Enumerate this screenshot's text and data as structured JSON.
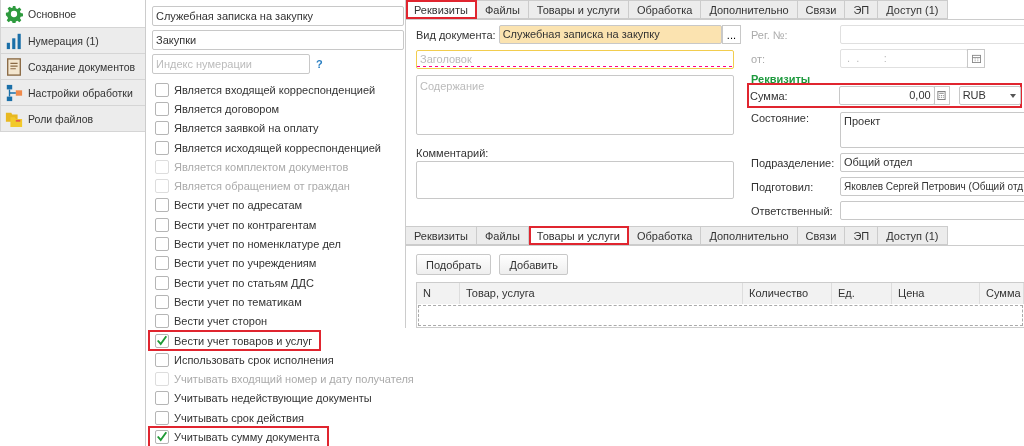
{
  "sidebar": {
    "items": [
      {
        "label": "Основное",
        "selected": true
      },
      {
        "label": "Нумерация (1)",
        "selected": false
      },
      {
        "label": "Создание документов",
        "selected": false
      },
      {
        "label": "Настройки обработки",
        "selected": false
      },
      {
        "label": "Роли файлов",
        "selected": false
      }
    ]
  },
  "form": {
    "fields": [
      {
        "value": "Служебная записка на закупку"
      },
      {
        "value": "Закупки"
      }
    ],
    "index_field": {
      "placeholder": "Индекс нумерации"
    },
    "help": "?",
    "checkboxes": [
      {
        "label": "Является входящей корреспонденцией",
        "checked": false,
        "disabled": false,
        "highlighted": false
      },
      {
        "label": "Является договором",
        "checked": false,
        "disabled": false,
        "highlighted": false
      },
      {
        "label": "Является заявкой на оплату",
        "checked": false,
        "disabled": false,
        "highlighted": false
      },
      {
        "label": "Является исходящей корреспонденцией",
        "checked": false,
        "disabled": false,
        "highlighted": false
      },
      {
        "label": "Является комплектом документов",
        "checked": false,
        "disabled": true,
        "highlighted": false
      },
      {
        "label": "Является обращением от граждан",
        "checked": false,
        "disabled": true,
        "highlighted": false
      },
      {
        "label": "Вести учет по адресатам",
        "checked": false,
        "disabled": false,
        "highlighted": false
      },
      {
        "label": "Вести учет по контрагентам",
        "checked": false,
        "disabled": false,
        "highlighted": false
      },
      {
        "label": "Вести учет по номенклатуре дел",
        "checked": false,
        "disabled": false,
        "highlighted": false
      },
      {
        "label": "Вести учет по учреждениям",
        "checked": false,
        "disabled": false,
        "highlighted": false
      },
      {
        "label": "Вести учет по статьям ДДС",
        "checked": false,
        "disabled": false,
        "highlighted": false
      },
      {
        "label": "Вести учет по тематикам",
        "checked": false,
        "disabled": false,
        "highlighted": false
      },
      {
        "label": "Вести учет сторон",
        "checked": false,
        "disabled": false,
        "highlighted": false
      },
      {
        "label": "Вести учет товаров и услуг",
        "checked": true,
        "disabled": false,
        "highlighted": true
      },
      {
        "label": "Использовать срок исполнения",
        "checked": false,
        "disabled": false,
        "highlighted": false
      },
      {
        "label": "Учитывать входящий номер и дату получателя",
        "checked": false,
        "disabled": true,
        "highlighted": false
      },
      {
        "label": "Учитывать недействующие документы",
        "checked": false,
        "disabled": false,
        "highlighted": false
      },
      {
        "label": "Учитывать срок действия",
        "checked": false,
        "disabled": false,
        "highlighted": false
      },
      {
        "label": "Учитывать сумму документа",
        "checked": true,
        "disabled": false,
        "highlighted": true
      }
    ]
  },
  "document": {
    "tabs": [
      {
        "label": "Реквизиты",
        "selected": true,
        "highlighted": true
      },
      {
        "label": "Файлы",
        "selected": false,
        "highlighted": false
      },
      {
        "label": "Товары и услуги",
        "selected": false,
        "highlighted": false
      },
      {
        "label": "Обработка",
        "selected": false,
        "highlighted": false
      },
      {
        "label": "Дополнительно",
        "selected": false,
        "highlighted": false
      },
      {
        "label": "Связи",
        "selected": false,
        "highlighted": false
      },
      {
        "label": "ЭП",
        "selected": false,
        "highlighted": false
      },
      {
        "label": "Доступ (1)",
        "selected": false,
        "highlighted": false
      }
    ],
    "doc_type": {
      "label": "Вид документа:",
      "value": "Служебная записка на закупку",
      "button": "..."
    },
    "title_field": {
      "placeholder": "Заголовок"
    },
    "content_field": {
      "placeholder": "Содержание"
    },
    "comment": {
      "label": "Комментарий:"
    },
    "reg_number": {
      "label": "Рег. №:"
    },
    "date": {
      "label": "от:",
      "placeholder": " .  .        :"
    },
    "section_title": "Реквизиты",
    "sum": {
      "label": "Сумма:",
      "value": "0,00",
      "currency": "RUB",
      "highlighted": true
    },
    "state": {
      "label": "Состояние:",
      "value": "Проект"
    },
    "department": {
      "label": "Подразделение:",
      "value": "Общий отдел"
    },
    "prepared_by": {
      "label": "Подготовил:",
      "value": "Яковлев Сергей Петрович (Общий отд"
    },
    "responsible": {
      "label": "Ответственный:"
    }
  },
  "goods": {
    "tabs": [
      {
        "label": "Реквизиты",
        "selected": false,
        "highlighted": false
      },
      {
        "label": "Файлы",
        "selected": false,
        "highlighted": false
      },
      {
        "label": "Товары и услуги",
        "selected": true,
        "highlighted": true
      },
      {
        "label": "Обработка",
        "selected": false,
        "highlighted": false
      },
      {
        "label": "Дополнительно",
        "selected": false,
        "highlighted": false
      },
      {
        "label": "Связи",
        "selected": false,
        "highlighted": false
      },
      {
        "label": "ЭП",
        "selected": false,
        "highlighted": false
      },
      {
        "label": "Доступ (1)",
        "selected": false,
        "highlighted": false
      }
    ],
    "buttons": [
      "Подобрать",
      "Добавить"
    ],
    "table": {
      "columns": [
        "N",
        "Товар, услуга",
        "Количество",
        "Ед.",
        "Цена",
        "Сумма"
      ]
    }
  }
}
